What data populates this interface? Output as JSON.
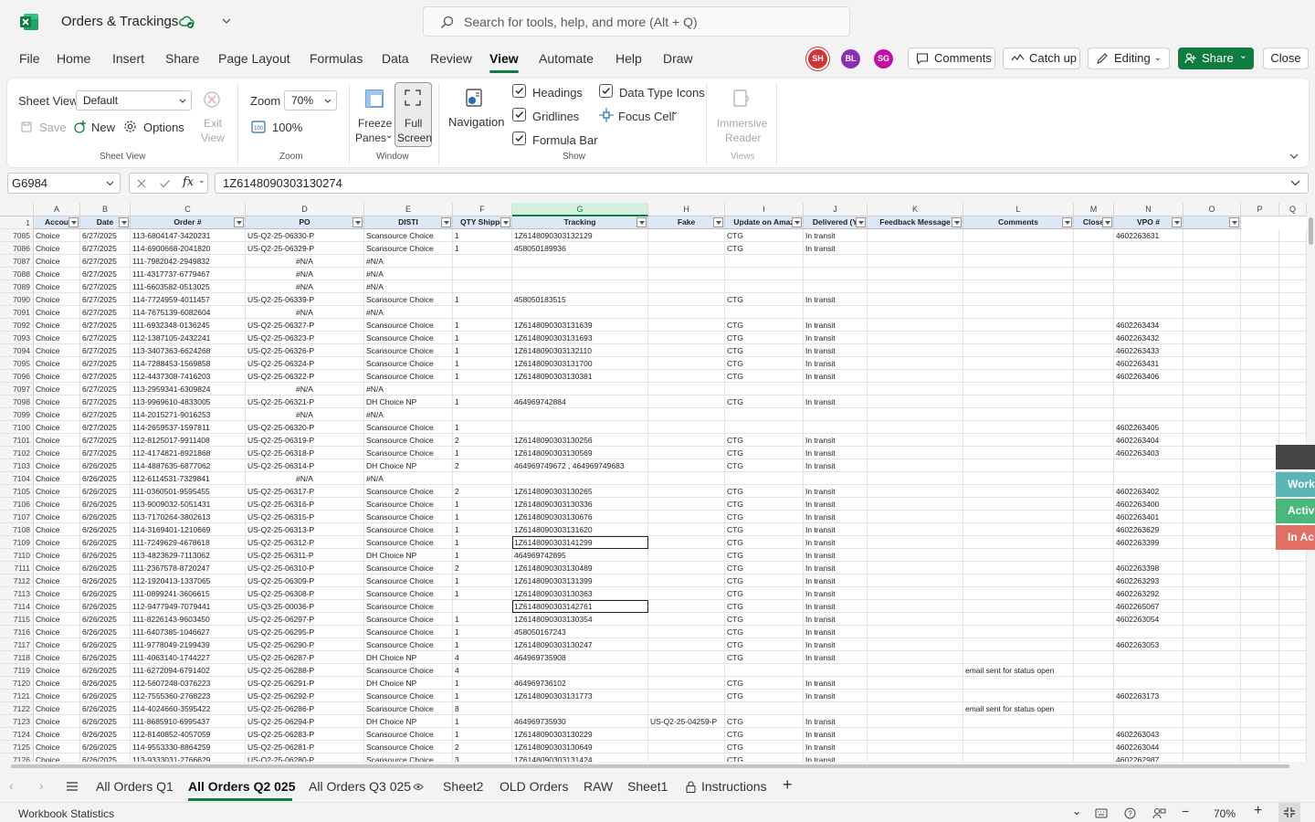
{
  "title_bar": {
    "doc_title": "Orders & Trackings",
    "search_placeholder": "Search for tools, help, and more (Alt + Q)"
  },
  "menu": [
    "File",
    "Home",
    "Insert",
    "Share",
    "Page Layout",
    "Formulas",
    "Data",
    "Review",
    "View",
    "Automate",
    "Help",
    "Draw"
  ],
  "active_menu": "View",
  "collaborators": [
    {
      "initials": "SH",
      "color": "#d13438"
    },
    {
      "initials": "BL",
      "color": "#8a2fb3"
    },
    {
      "initials": "SG",
      "color": "#c40fa4"
    }
  ],
  "header_buttons": {
    "comments": "Comments",
    "catchup": "Catch up",
    "editing": "Editing",
    "share": "Share",
    "close": "Close"
  },
  "ribbon": {
    "sheet_view_label": "Sheet View",
    "sheet_view_value": "Default",
    "save": "Save",
    "new": "New",
    "options": "Options",
    "exit_view_1": "Exit",
    "exit_view_2": "View",
    "group_sheet_view": "Sheet View",
    "zoom_label": "Zoom",
    "zoom_value": "70%",
    "zoom_100": "100%",
    "group_zoom": "Zoom",
    "freeze_1": "Freeze",
    "freeze_2": "Panes",
    "full_1": "Full",
    "full_2": "Screen",
    "group_window": "Window",
    "navigation": "Navigation",
    "headings": "Headings",
    "gridlines": "Gridlines",
    "formula_bar": "Formula Bar",
    "data_type_icons": "Data Type Icons",
    "focus_cell": "Focus Cell",
    "group_show": "Show",
    "immersive_1": "Immersive",
    "immersive_2": "Reader",
    "group_views": "Views"
  },
  "formula_bar": {
    "name_box": "G6984",
    "formula": "1Z6148090303130274"
  },
  "columns": [
    "A",
    "B",
    "C",
    "D",
    "E",
    "F",
    "G",
    "H",
    "I",
    "J",
    "K",
    "L",
    "M",
    "N",
    "O",
    "P",
    "Q"
  ],
  "headers": [
    "Accou",
    "Date",
    "Order #",
    "PO",
    "DISTI",
    "QTY Shippe",
    "Tracking",
    "Fake",
    "Update on Amaz",
    "Delivered (Y",
    "Feedback Message",
    "Comments",
    "Close",
    "VPO #",
    ""
  ],
  "rows": [
    [
      "7085",
      "Choice",
      "6/27/2025",
      "113-6804147-3420231",
      "US-Q2-25-06330-P",
      "Scansource Choice",
      "1",
      "1Z6148090303132129",
      "",
      "CTG",
      "In transit",
      "",
      "",
      "",
      "4602263631"
    ],
    [
      "7086",
      "Choice",
      "6/27/2025",
      "114-6900668-2041820",
      "US-Q2-25-06329-P",
      "Scansource Choice",
      "1",
      "458050189936",
      "",
      "CTG",
      "In transit",
      "",
      "",
      "",
      ""
    ],
    [
      "7087",
      "Choice",
      "6/27/2025",
      "111-7982042-2949832",
      "#N/A",
      "#N/A",
      "",
      "",
      "",
      "",
      "",
      "",
      "",
      "",
      ""
    ],
    [
      "7088",
      "Choice",
      "6/27/2025",
      "111-4317737-6779467",
      "#N/A",
      "#N/A",
      "",
      "",
      "",
      "",
      "",
      "",
      "",
      "",
      ""
    ],
    [
      "7089",
      "Choice",
      "6/27/2025",
      "111-6603582-0513025",
      "#N/A",
      "#N/A",
      "",
      "",
      "",
      "",
      "",
      "",
      "",
      "",
      ""
    ],
    [
      "7090",
      "Choice",
      "6/27/2025",
      "114-7724959-4011457",
      "US-Q2-25-06339-P",
      "Scansource Choice",
      "1",
      "458050183515",
      "",
      "CTG",
      "In transit",
      "",
      "",
      "",
      ""
    ],
    [
      "7091",
      "Choice",
      "6/27/2025",
      "114-7675139-6082604",
      "#N/A",
      "#N/A",
      "",
      "",
      "",
      "",
      "",
      "",
      "",
      "",
      ""
    ],
    [
      "7092",
      "Choice",
      "6/27/2025",
      "111-6932348-0136245",
      "US-Q2-25-06327-P",
      "Scansource Choice",
      "1",
      "1Z6148090303131639",
      "",
      "CTG",
      "In transit",
      "",
      "",
      "",
      "4602263434"
    ],
    [
      "7093",
      "Choice",
      "6/27/2025",
      "112-1387105-2432241",
      "US-Q2-25-06323-P",
      "Scansource Choice",
      "1",
      "1Z6148090303131693",
      "",
      "CTG",
      "In transit",
      "",
      "",
      "",
      "4602263432"
    ],
    [
      "7094",
      "Choice",
      "6/27/2025",
      "113-3407363-6624268",
      "US-Q2-25-06326-P",
      "Scansource Choice",
      "1",
      "1Z6148090303132110",
      "",
      "CTG",
      "In transit",
      "",
      "",
      "",
      "4602263433"
    ],
    [
      "7095",
      "Choice",
      "6/27/2025",
      "114-7288453-1569858",
      "US-Q2-25-06324-P",
      "Scansource Choice",
      "1",
      "1Z6148090303131700",
      "",
      "CTG",
      "In transit",
      "",
      "",
      "",
      "4602263431"
    ],
    [
      "7096",
      "Choice",
      "6/27/2025",
      "112-4437308-7416203",
      "US-Q2-25-06322-P",
      "Scansource Choice",
      "1",
      "1Z6148090303130381",
      "",
      "CTG",
      "In transit",
      "",
      "",
      "",
      "4602263406"
    ],
    [
      "7097",
      "Choice",
      "6/27/2025",
      "113-2959341-6309824",
      "#N/A",
      "#N/A",
      "",
      "",
      "",
      "",
      "",
      "",
      "",
      "",
      ""
    ],
    [
      "7098",
      "Choice",
      "6/27/2025",
      "113-9969610-4833005",
      "US-Q2-25-06321-P",
      "DH Choice NP",
      "1",
      "464969742884",
      "",
      "CTG",
      "In transit",
      "",
      "",
      "",
      ""
    ],
    [
      "7099",
      "Choice",
      "6/27/2025",
      "114-2015271-9016253",
      "#N/A",
      "#N/A",
      "",
      "",
      "",
      "",
      "",
      "",
      "",
      "",
      ""
    ],
    [
      "7100",
      "Choice",
      "6/27/2025",
      "114-2659537-1597811",
      "US-Q2-25-06320-P",
      "Scansource Choice",
      "1",
      "",
      "",
      "",
      "",
      "",
      "",
      "",
      "4602263405"
    ],
    [
      "7101",
      "Choice",
      "6/27/2025",
      "112-8125017-9911408",
      "US-Q2-25-06319-P",
      "Scansource Choice",
      "2",
      "1Z6148090303130256",
      "",
      "CTG",
      "In transit",
      "",
      "",
      "",
      "4602263404"
    ],
    [
      "7102",
      "Choice",
      "6/27/2025",
      "112-4174821-8921868",
      "US-Q2-25-06318-P",
      "Scansource Choice",
      "1",
      "1Z6148090303130569",
      "",
      "CTG",
      "In transit",
      "",
      "",
      "",
      "4602263403"
    ],
    [
      "7103",
      "Choice",
      "6/26/2025",
      "114-4887635-6877062",
      "US-Q2-25-06314-P",
      "DH Choice NP",
      "2",
      "464969749672 , 464969749683",
      "",
      "CTG",
      "In transit",
      "",
      "",
      "",
      ""
    ],
    [
      "7104",
      "Choice",
      "6/26/2025",
      "112-6114531-7329841",
      "#N/A",
      "#N/A",
      "",
      "",
      "",
      "",
      "",
      "",
      "",
      "",
      ""
    ],
    [
      "7105",
      "Choice",
      "6/26/2025",
      "111-0360501-9595455",
      "US-Q2-25-06317-P",
      "Scansource Choice",
      "2",
      "1Z6148090303130265",
      "",
      "CTG",
      "In transit",
      "",
      "",
      "",
      "4602263402"
    ],
    [
      "7106",
      "Choice",
      "6/26/2025",
      "113-9009032-5051431",
      "US-Q2-25-06316-P",
      "Scansource Choice",
      "1",
      "1Z6148090303130336",
      "",
      "CTG",
      "In transit",
      "",
      "",
      "",
      "4602263400"
    ],
    [
      "7107",
      "Choice",
      "6/26/2025",
      "113-7170264-3802613",
      "US-Q2-25-06315-P",
      "Scansource Choice",
      "1",
      "1Z6148090303130676",
      "",
      "CTG",
      "In transit",
      "",
      "",
      "",
      "4602263401"
    ],
    [
      "7108",
      "Choice",
      "6/26/2025",
      "114-3169401-1210669",
      "US-Q2-25-06313-P",
      "Scansource Choice",
      "1",
      "1Z6148090303131620",
      "",
      "CTG",
      "In transit",
      "",
      "",
      "",
      "4602263629"
    ],
    [
      "7109",
      "Choice",
      "6/26/2025",
      "111-7249629-4678618",
      "US-Q2-25-06312-P",
      "Scansource Choice",
      "1",
      "1Z6148090303141299",
      "",
      "CTG",
      "In transit",
      "",
      "",
      "",
      "4602263399"
    ],
    [
      "7110",
      "Choice",
      "6/26/2025",
      "113-4823629-7113062",
      "US-Q2-25-06311-P",
      "DH Choice NP",
      "1",
      "464969742895",
      "",
      "CTG",
      "In transit",
      "",
      "",
      "",
      ""
    ],
    [
      "7111",
      "Choice",
      "6/26/2025",
      "111-2367578-8720247",
      "US-Q2-25-06310-P",
      "Scansource Choice",
      "2",
      "1Z6148090303130489",
      "",
      "CTG",
      "In transit",
      "",
      "",
      "",
      "4602263398"
    ],
    [
      "7112",
      "Choice",
      "6/26/2025",
      "112-1920413-1337065",
      "US-Q2-25-06309-P",
      "Scansource Choice",
      "1",
      "1Z6148090303131399",
      "",
      "CTG",
      "In transit",
      "",
      "",
      "",
      "4602263293"
    ],
    [
      "7113",
      "Choice",
      "6/26/2025",
      "111-0899241-3606615",
      "US-Q2-25-06308-P",
      "Scansource Choice",
      "1",
      "1Z6148090303130363",
      "",
      "CTG",
      "In transit",
      "",
      "",
      "",
      "4602263292"
    ],
    [
      "7114",
      "Choice",
      "6/26/2025",
      "112-9477949-7079441",
      "US-Q3-25-00036-P",
      "Scansource Choice",
      "",
      "1Z6148090303142761",
      "",
      "CTG",
      "In transit",
      "",
      "",
      "",
      "4602265067"
    ],
    [
      "7115",
      "Choice",
      "6/26/2025",
      "111-8226143-9603450",
      "US-Q2-25-06297-P",
      "Scansource Choice",
      "1",
      "1Z6148090303130354",
      "",
      "CTG",
      "In transit",
      "",
      "",
      "",
      "4602263054"
    ],
    [
      "7116",
      "Choice",
      "6/26/2025",
      "111-6407385-1046627",
      "US-Q2-25-06295-P",
      "Scansource Choice",
      "1",
      "458050167243",
      "",
      "CTG",
      "In transit",
      "",
      "",
      "",
      ""
    ],
    [
      "7117",
      "Choice",
      "6/26/2025",
      "111-9778049-2199439",
      "US-Q2-25-06290-P",
      "Scansource Choice",
      "1",
      "1Z6148090303130247",
      "",
      "CTG",
      "In transit",
      "",
      "",
      "",
      "4602263053"
    ],
    [
      "7118",
      "Choice",
      "6/26/2025",
      "111-4063140-1744227",
      "US-Q2-25-06287-P",
      "DH Choice NP",
      "4",
      "464969735908",
      "",
      "CTG",
      "In transit",
      "",
      "",
      "",
      ""
    ],
    [
      "7119",
      "Choice",
      "6/26/2025",
      "111-6272094-6791402",
      "US-Q2-25-06288-P",
      "Scansource Choice",
      "4",
      "",
      "",
      "",
      "",
      "",
      "email sent for status open",
      "",
      ""
    ],
    [
      "7120",
      "Choice",
      "6/26/2025",
      "112-5607248-0376223",
      "US-Q2-25-06291-P",
      "DH Choice NP",
      "1",
      "464969736102",
      "",
      "CTG",
      "In transit",
      "",
      "",
      "",
      ""
    ],
    [
      "7121",
      "Choice",
      "6/26/2025",
      "112-7555360-2768223",
      "US-Q2-25-06292-P",
      "Scansource Choice",
      "1",
      "1Z6148090303131773",
      "",
      "CTG",
      "In transit",
      "",
      "",
      "",
      "4602263173"
    ],
    [
      "7122",
      "Choice",
      "6/26/2025",
      "114-4024660-3595422",
      "US-Q2-25-06286-P",
      "Scansource Choice",
      "8",
      "",
      "",
      "",
      "",
      "",
      "email sent for status open",
      "",
      ""
    ],
    [
      "7123",
      "Choice",
      "6/26/2025",
      "111-8685910-6995437",
      "US-Q2-25-06294-P",
      "DH Choice NP",
      "1",
      "464969735930",
      "US-Q2-25-04259-P",
      "CTG",
      "In transit",
      "",
      "",
      "",
      ""
    ],
    [
      "7124",
      "Choice",
      "6/26/2025",
      "112-8140852-4057059",
      "US-Q2-25-06283-P",
      "Scansource Choice",
      "1",
      "1Z6148090303130229",
      "",
      "CTG",
      "In transit",
      "",
      "",
      "",
      "4602263043"
    ],
    [
      "7125",
      "Choice",
      "6/26/2025",
      "114-9553330-8864259",
      "US-Q2-25-06281-P",
      "Scansource Choice",
      "2",
      "1Z6148090303130649",
      "",
      "CTG",
      "In transit",
      "",
      "",
      "",
      "4602263044"
    ],
    [
      "7126",
      "Choice",
      "6/26/2025",
      "113-9333031-2766629",
      "US-Q2-25-06280-P",
      "Scansource Choice",
      "3",
      "1Z6148090303131424",
      "",
      "CTG",
      "In transit",
      "",
      "",
      "",
      "4602262987"
    ]
  ],
  "side_cards": [
    {
      "label": "Work",
      "color": "#5bb5b5"
    },
    {
      "label": "Activ",
      "color": "#4ab87d"
    },
    {
      "label": "In Ac",
      "color": "#e06f66"
    }
  ],
  "sheet_tabs": [
    "All Orders Q1",
    "All Orders Q2 025",
    "All Orders Q3 025",
    "Sheet2",
    "OLD Orders",
    "RAW",
    "Sheet1",
    "Instructions"
  ],
  "active_sheet": "All Orders Q2 025",
  "status": {
    "left": "Workbook Statistics",
    "zoom": "70%"
  }
}
